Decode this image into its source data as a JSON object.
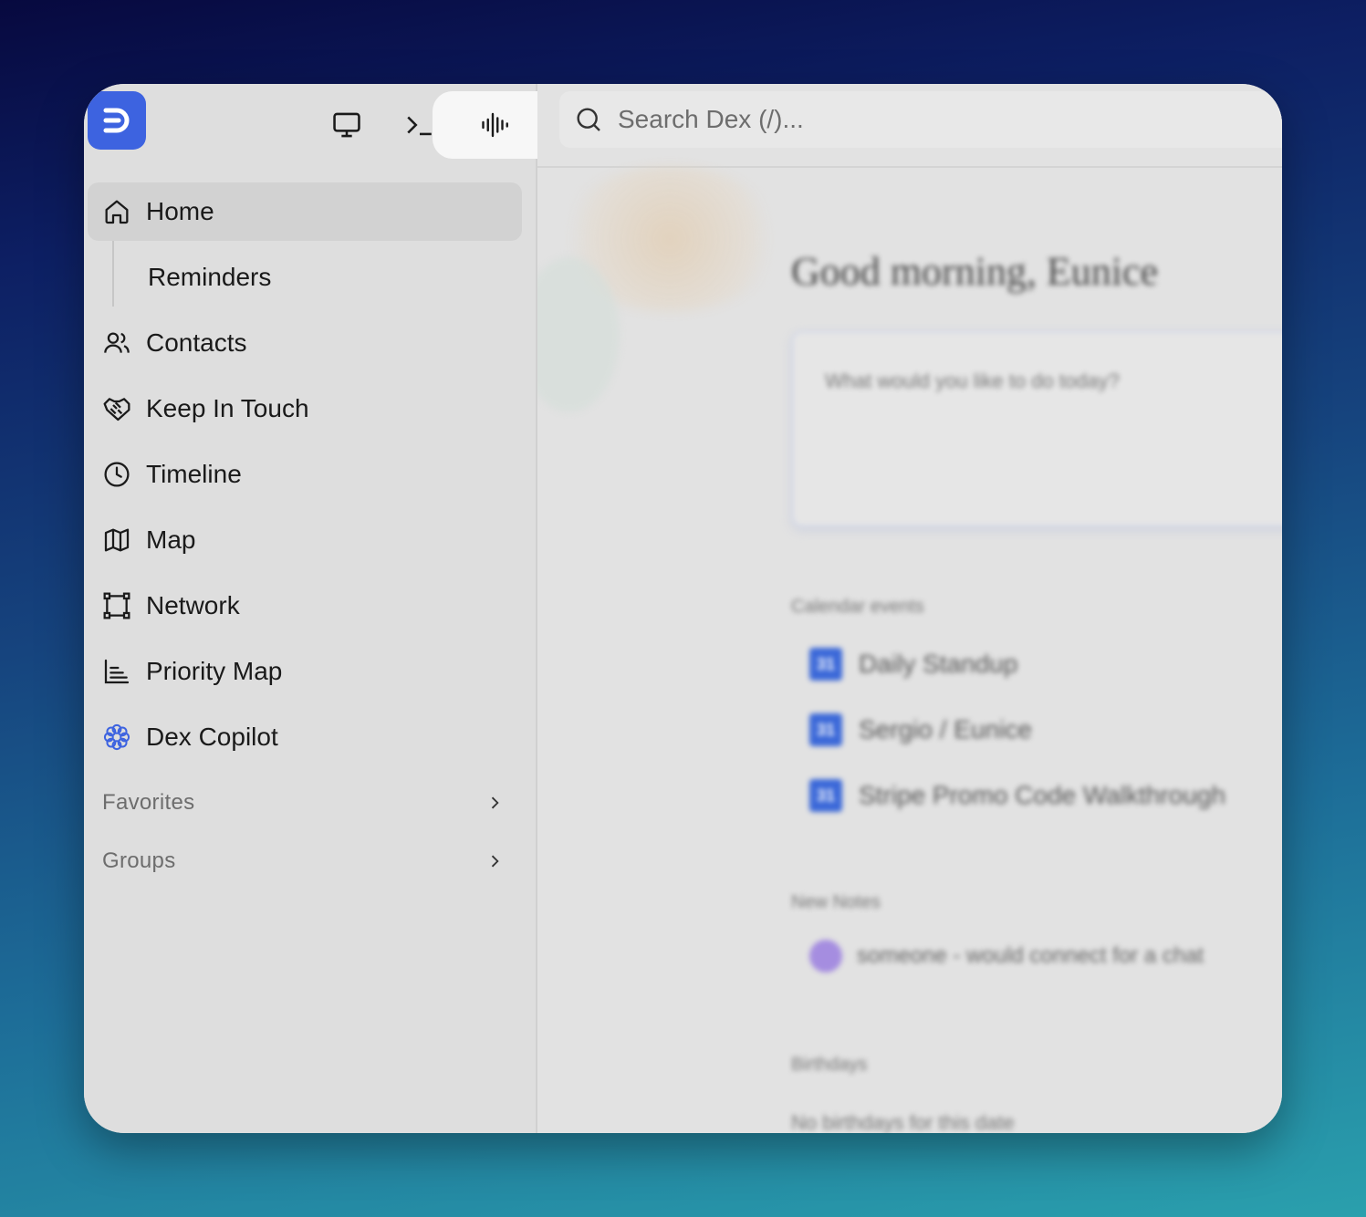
{
  "toolbar": {
    "logo": "dex-logo",
    "buttons": [
      "monitor-icon",
      "terminal-icon",
      "voice-waveform-icon"
    ],
    "active_button": "voice-waveform-icon"
  },
  "search": {
    "placeholder": "Search Dex (/)..."
  },
  "sidebar": {
    "items": [
      {
        "label": "Home",
        "icon": "home-icon",
        "active": true
      },
      {
        "label": "Reminders",
        "icon": null,
        "sub": true
      },
      {
        "label": "Contacts",
        "icon": "contacts-icon"
      },
      {
        "label": "Keep In Touch",
        "icon": "handshake-icon"
      },
      {
        "label": "Timeline",
        "icon": "clock-icon"
      },
      {
        "label": "Map",
        "icon": "map-icon"
      },
      {
        "label": "Network",
        "icon": "network-icon"
      },
      {
        "label": "Priority Map",
        "icon": "chart-icon"
      },
      {
        "label": "Dex Copilot",
        "icon": "copilot-flower-icon",
        "accent": "#3d63e0"
      }
    ],
    "sections": [
      {
        "label": "Favorites"
      },
      {
        "label": "Groups"
      }
    ]
  },
  "main": {
    "greeting": "Good morning, Eunice",
    "ask_placeholder": "What would you like to do today?",
    "calendar_title": "Calendar events",
    "events": [
      {
        "label": "Daily Standup"
      },
      {
        "label": "Sergio / Eunice"
      },
      {
        "label": "Stripe Promo Code Walkthrough"
      }
    ],
    "notes_title": "New Notes",
    "notes": [
      {
        "label": "someone - would connect for a chat"
      }
    ],
    "birthdays_title": "Birthdays",
    "birthdays_text": "No birthdays for this date"
  },
  "colors": {
    "accent": "#3d63e0",
    "calendar": "#3b68d8"
  }
}
